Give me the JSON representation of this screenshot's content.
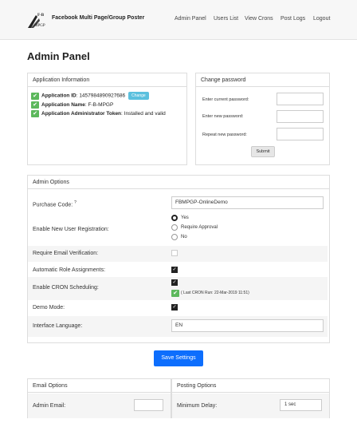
{
  "nav": {
    "logo_text_top": "F-B",
    "logo_text_bottom": "MPGP",
    "brand": "Facebook Multi Page/Group Poster",
    "items": [
      "Admin Panel",
      "Users List",
      "View Crons",
      "Post Logs",
      "Logout"
    ]
  },
  "page_title": "Admin Panel",
  "app_info": {
    "heading": "Application Information",
    "id_label": "Application ID",
    "id_value": ": 1457984890927686",
    "change_label": "Change",
    "name_label": "Application Name",
    "name_value": ": F-B-MPGP",
    "token_label": "Application Administrator Token",
    "token_value": ": Installed and valid"
  },
  "change_password": {
    "heading": "Change password",
    "current_label": "Enter current password:",
    "new_label": "Enter new password:",
    "repeat_label": "Repeat new password:",
    "submit_label": "Submit"
  },
  "admin_options": {
    "heading": "Admin Options",
    "purchase_code_label": "Purchase Code:",
    "purchase_code_hint": "?",
    "purchase_code_value": "FBMPGP-OnlineDemo",
    "registration_label": "Enable New User Registration:",
    "registration_options": [
      "Yes",
      "Require Approval",
      "No"
    ],
    "registration_selected": "Yes",
    "email_verification_label": "Require Email Verification:",
    "email_verification_checked": false,
    "role_assign_label": "Automatic Role Assignments:",
    "role_assign_checked": true,
    "cron_label": "Enable CRON Scheduling:",
    "cron_checked": true,
    "cron_note": "( Last CRON Run: 22-Mar-2019 11:51)",
    "demo_label": "Demo Mode:",
    "demo_checked": true,
    "language_label": "Interface Language:",
    "language_value": "EN"
  },
  "save_label": "Save Settings",
  "email_options": {
    "heading": "Email Options",
    "admin_email_label": "Admin Email:",
    "admin_email_value": ""
  },
  "posting_options": {
    "heading": "Posting Options",
    "min_delay_label": "Minimum Delay:",
    "min_delay_value": "1 sec"
  },
  "colors": {
    "primary": "#0d6efd",
    "success": "#5cb85c",
    "info": "#5bc0de"
  }
}
